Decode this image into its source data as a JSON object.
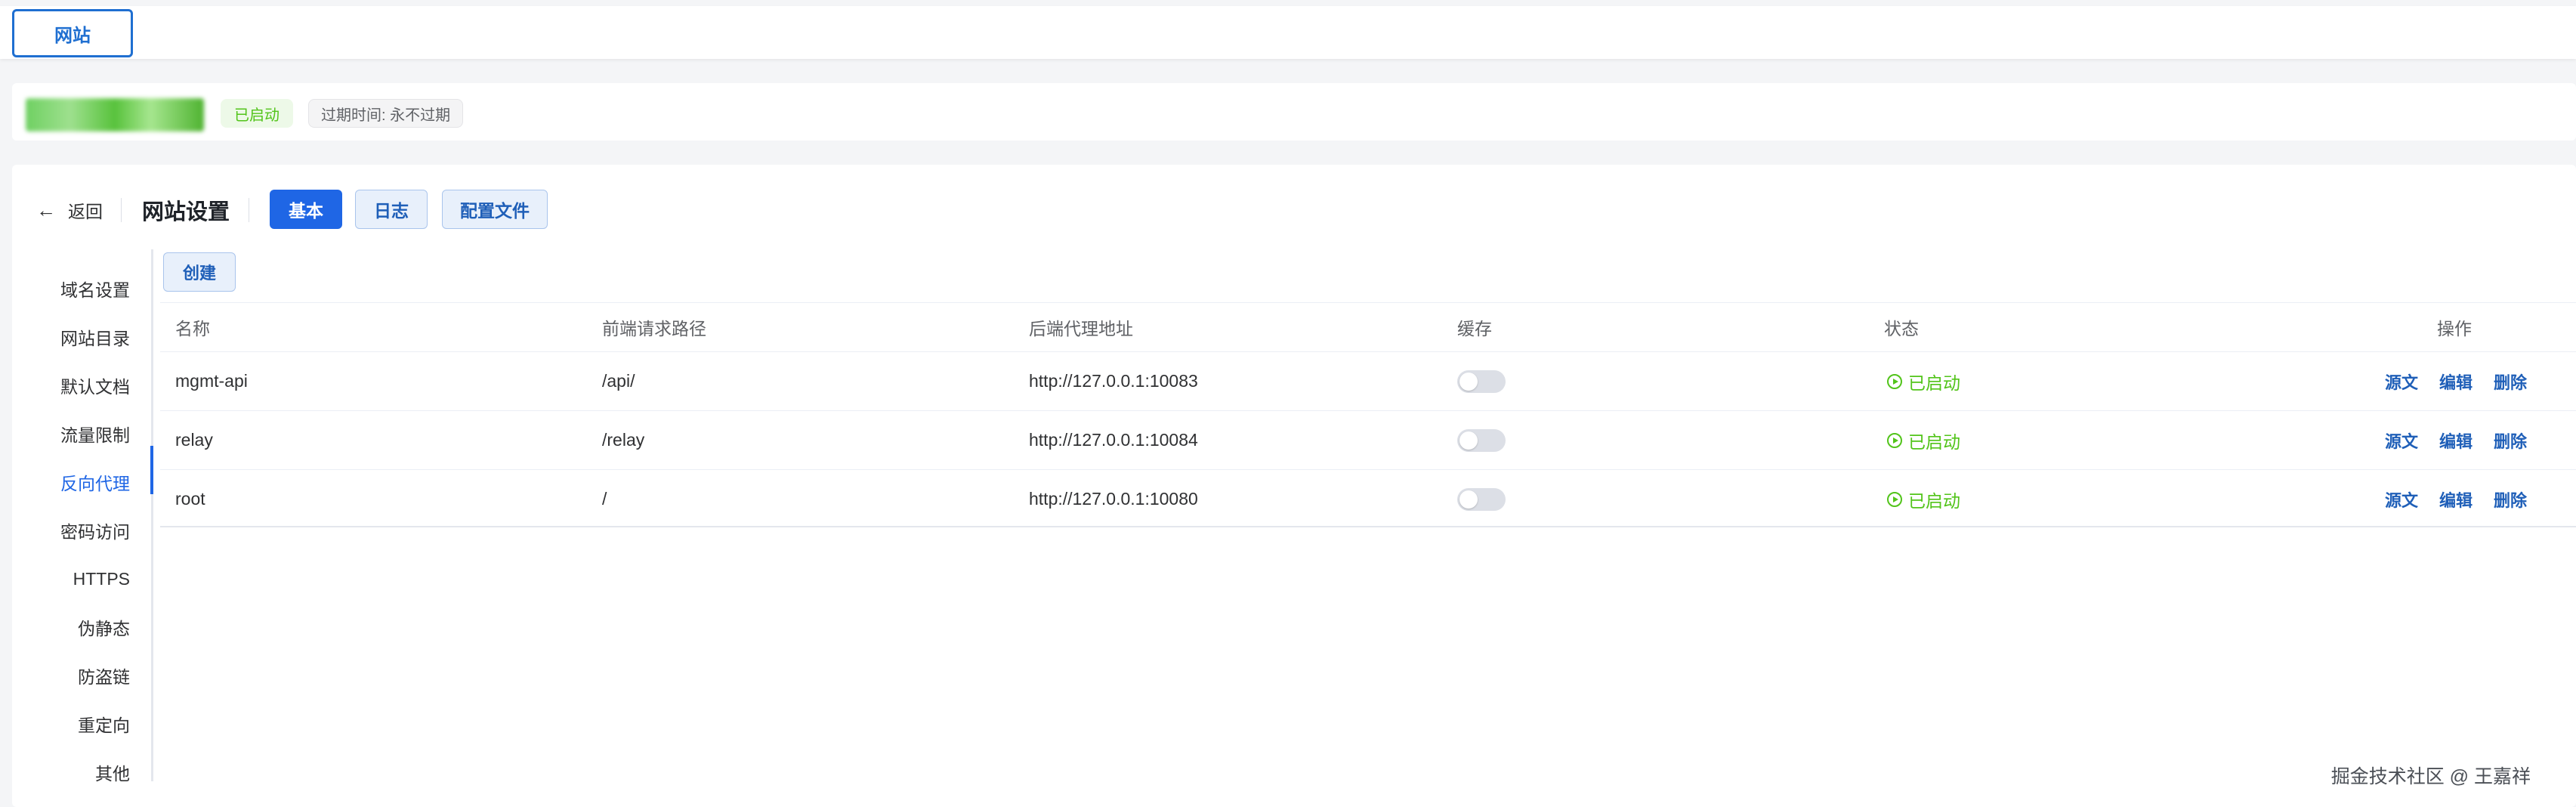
{
  "top_tab": {
    "label": "网站"
  },
  "site_info": {
    "status": "已启动",
    "expire": "过期时间: 永不过期"
  },
  "header": {
    "back_label": "返回",
    "title": "网站设置",
    "tabs": [
      "基本",
      "日志",
      "配置文件"
    ],
    "active_tab": "基本"
  },
  "menu": {
    "items": [
      "域名设置",
      "网站目录",
      "默认文档",
      "流量限制",
      "反向代理",
      "密码访问",
      "HTTPS",
      "伪静态",
      "防盗链",
      "重定向",
      "其他"
    ],
    "active": "反向代理"
  },
  "toolbar": {
    "create_label": "创建"
  },
  "table": {
    "columns": [
      "名称",
      "前端请求路径",
      "后端代理地址",
      "缓存",
      "状态",
      "操作"
    ],
    "rows": [
      {
        "name": "mgmt-api",
        "path": "/api/",
        "backend": "http://127.0.0.1:10083",
        "cache": false,
        "status": "已启动"
      },
      {
        "name": "relay",
        "path": "/relay",
        "backend": "http://127.0.0.1:10084",
        "cache": false,
        "status": "已启动"
      },
      {
        "name": "root",
        "path": "/",
        "backend": "http://127.0.0.1:10080",
        "cache": false,
        "status": "已启动"
      }
    ],
    "actions": [
      "源文",
      "编辑",
      "删除"
    ]
  },
  "watermark": "掘金技术社区 @ 王嘉祥",
  "colors": {
    "primary": "#1f66e5",
    "success": "#52c41a",
    "link": "#1f5fb8"
  }
}
